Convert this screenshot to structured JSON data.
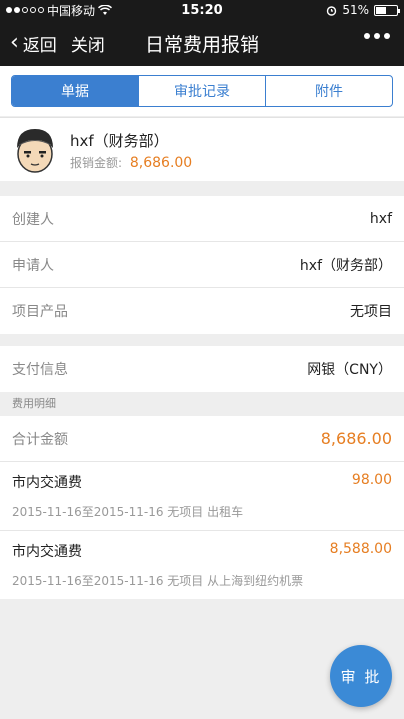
{
  "status_bar": {
    "carrier": "中国移动",
    "time": "15:20",
    "battery": "51%",
    "battery_level": 0.51,
    "wifi_icon": "wifi-icon",
    "alarm_icon": "alarm-icon"
  },
  "nav": {
    "back_label": "返回",
    "close_label": "关闭",
    "title": "日常费用报销"
  },
  "tabs": [
    {
      "label": "单据",
      "active": true
    },
    {
      "label": "审批记录",
      "active": false
    },
    {
      "label": "附件",
      "active": false
    }
  ],
  "user": {
    "name": "hxf（财务部）",
    "amount_label": "报销金额:",
    "amount_value": "8,686.00"
  },
  "info": {
    "creator_label": "创建人",
    "creator_value": "hxf",
    "applicant_label": "申请人",
    "applicant_value": "hxf（财务部）",
    "project_label": "项目产品",
    "project_value": "无项目"
  },
  "payment": {
    "label": "支付信息",
    "value": "网银（CNY）"
  },
  "details": {
    "section_title": "费用明细",
    "total_label": "合计金额",
    "total_value": "8,686.00",
    "items": [
      {
        "name": "市内交通费",
        "amount": "98.00",
        "desc": "2015-11-16至2015-11-16 无项目 出租车"
      },
      {
        "name": "市内交通费",
        "amount": "8,588.00",
        "desc": "2015-11-16至2015-11-16 无项目 从上海到纽约机票"
      }
    ]
  },
  "approve_button": "审 批",
  "colors": {
    "accent": "#3b7fd0",
    "amount": "#e67e22",
    "bar": "#1a1a1a"
  }
}
